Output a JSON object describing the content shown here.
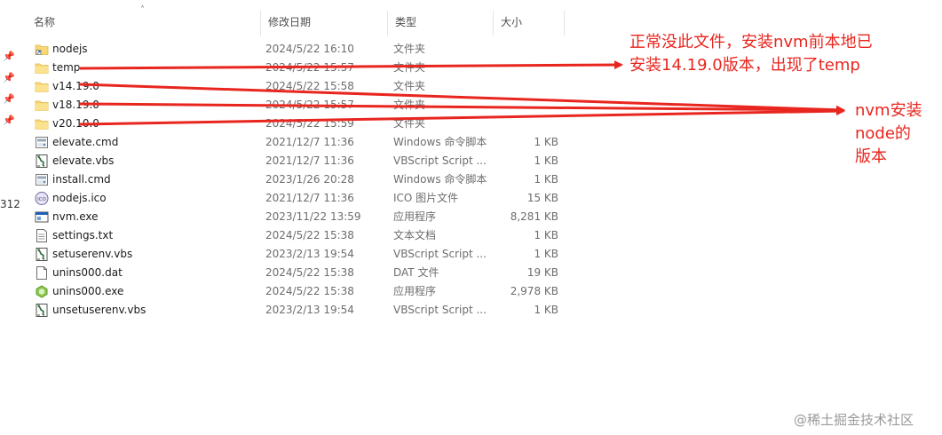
{
  "sidebar": {
    "partial_text": "312"
  },
  "columns": {
    "name": "名称",
    "date": "修改日期",
    "type": "类型",
    "size": "大小"
  },
  "files": [
    {
      "name": "nodejs",
      "date": "2024/5/22 16:10",
      "type": "文件夹",
      "size": "",
      "icon": "folder-shortcut-icon"
    },
    {
      "name": "temp",
      "date": "2024/5/22 15:57",
      "type": "文件夹",
      "size": "",
      "icon": "folder-icon"
    },
    {
      "name": "v14.19.0",
      "date": "2024/5/22 15:58",
      "type": "文件夹",
      "size": "",
      "icon": "folder-icon"
    },
    {
      "name": "v18.19.0",
      "date": "2024/5/22 15:57",
      "type": "文件夹",
      "size": "",
      "icon": "folder-icon"
    },
    {
      "name": "v20.10.0",
      "date": "2024/5/22 15:59",
      "type": "文件夹",
      "size": "",
      "icon": "folder-icon"
    },
    {
      "name": "elevate.cmd",
      "date": "2021/12/7 11:36",
      "type": "Windows 命令脚本",
      "size": "1 KB",
      "icon": "cmd-file-icon"
    },
    {
      "name": "elevate.vbs",
      "date": "2021/12/7 11:36",
      "type": "VBScript Script ...",
      "size": "1 KB",
      "icon": "vbs-file-icon"
    },
    {
      "name": "install.cmd",
      "date": "2023/1/26 20:28",
      "type": "Windows 命令脚本",
      "size": "1 KB",
      "icon": "cmd-file-icon"
    },
    {
      "name": "nodejs.ico",
      "date": "2021/12/7 11:36",
      "type": "ICO 图片文件",
      "size": "15 KB",
      "icon": "ico-file-icon"
    },
    {
      "name": "nvm.exe",
      "date": "2023/11/22 13:59",
      "type": "应用程序",
      "size": "8,281 KB",
      "icon": "exe-file-icon"
    },
    {
      "name": "settings.txt",
      "date": "2024/5/22 15:38",
      "type": "文本文档",
      "size": "1 KB",
      "icon": "txt-file-icon"
    },
    {
      "name": "setuserenv.vbs",
      "date": "2023/2/13 19:54",
      "type": "VBScript Script ...",
      "size": "1 KB",
      "icon": "vbs-file-icon"
    },
    {
      "name": "unins000.dat",
      "date": "2024/5/22 15:38",
      "type": "DAT 文件",
      "size": "19 KB",
      "icon": "dat-file-icon"
    },
    {
      "name": "unins000.exe",
      "date": "2024/5/22 15:38",
      "type": "应用程序",
      "size": "2,978 KB",
      "icon": "installer-exe-icon"
    },
    {
      "name": "unsetuserenv.vbs",
      "date": "2023/2/13 19:54",
      "type": "VBScript Script ...",
      "size": "1 KB",
      "icon": "vbs-file-icon"
    }
  ],
  "annotations": {
    "temp_note": "正常没此文件，安装nvm前本地已\n安装14.19.0版本，出现了temp",
    "versions_note": "nvm安装\nnode的\n版本",
    "color": "#e8261f"
  },
  "watermark": "@稀土掘金技术社区"
}
